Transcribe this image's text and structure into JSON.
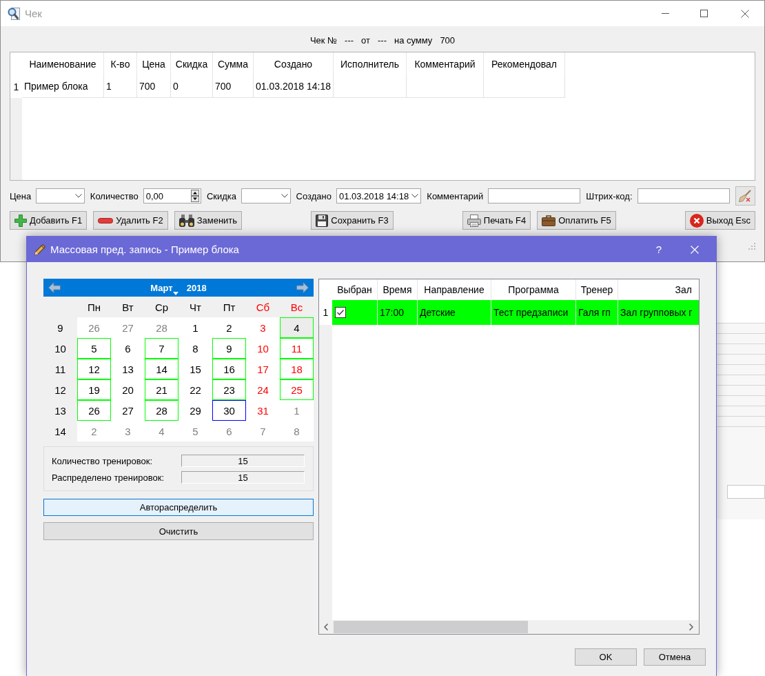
{
  "window": {
    "title": "Чек"
  },
  "receipt_header": [
    "Чек №",
    "---",
    "от",
    "---",
    "на сумму",
    "700"
  ],
  "items_table": {
    "columns": [
      "Наименование",
      "К-во",
      "Цена",
      "Скидка",
      "Сумма",
      "Создано",
      "Исполнитель",
      "Комментарий",
      "Рекомендовал"
    ],
    "rows": [
      {
        "number": "1",
        "cells": [
          "Пример блока",
          "1",
          "700",
          "0",
          "700",
          "01.03.2018 14:18",
          "",
          "",
          ""
        ]
      }
    ]
  },
  "editor_fields": [
    {
      "label": "Цена",
      "kind": "combo"
    },
    {
      "label": "Количество",
      "kind": "spin",
      "value": "0,00"
    },
    {
      "label": "Скидка",
      "kind": "combo"
    },
    {
      "label": "Создано",
      "kind": "combo",
      "value": "01.03.2018 14:18"
    },
    {
      "label": "Комментарий",
      "kind": "text"
    },
    {
      "label": "Штрих-код:",
      "kind": "text"
    }
  ],
  "action_groups": [
    {
      "buttons": [
        {
          "label": "Добавить F1",
          "kind": "add"
        },
        {
          "label": "Удалить F2",
          "kind": "delete"
        },
        {
          "label": "Заменить",
          "kind": "replace"
        }
      ]
    },
    {
      "buttons": [
        {
          "label": "Сохранить F3",
          "kind": "save"
        }
      ]
    },
    {
      "buttons": [
        {
          "label": "Печать F4",
          "kind": "print"
        },
        {
          "label": "Оплатить F5",
          "kind": "pay"
        }
      ]
    },
    {
      "buttons": [
        {
          "label": "Выход Esc",
          "kind": "exit"
        }
      ]
    }
  ],
  "dialog": {
    "title": "Массовая пред. запись - Пример блока",
    "help": "?",
    "calendar": {
      "month": "Март",
      "year": "2018",
      "weekdays": [
        {
          "label": "Пн",
          "weekend": false
        },
        {
          "label": "Вт",
          "weekend": false
        },
        {
          "label": "Ср",
          "weekend": false
        },
        {
          "label": "Чт",
          "weekend": false
        },
        {
          "label": "Пт",
          "weekend": false
        },
        {
          "label": "Сб",
          "weekend": true
        },
        {
          "label": "Вс",
          "weekend": true
        }
      ],
      "weeks": [
        {
          "number": "9",
          "days": [
            {
              "day": "26",
              "muted": true,
              "marked": false,
              "current": false,
              "selected": false
            },
            {
              "day": "27",
              "muted": true,
              "marked": false,
              "current": false,
              "selected": false
            },
            {
              "day": "28",
              "muted": true,
              "marked": false,
              "current": false,
              "selected": false
            },
            {
              "day": "1",
              "muted": false,
              "marked": false,
              "current": false,
              "selected": false
            },
            {
              "day": "2",
              "muted": false,
              "marked": false,
              "current": false,
              "selected": false
            },
            {
              "day": "3",
              "muted": false,
              "marked": false,
              "current": false,
              "selected": false
            },
            {
              "day": "4",
              "muted": false,
              "marked": true,
              "current": false,
              "selected": true
            }
          ]
        },
        {
          "number": "10",
          "days": [
            {
              "day": "5",
              "muted": false,
              "marked": true,
              "current": false,
              "selected": false
            },
            {
              "day": "6",
              "muted": false,
              "marked": false,
              "current": false,
              "selected": false
            },
            {
              "day": "7",
              "muted": false,
              "marked": true,
              "current": false,
              "selected": false
            },
            {
              "day": "8",
              "muted": false,
              "marked": false,
              "current": false,
              "selected": false
            },
            {
              "day": "9",
              "muted": false,
              "marked": true,
              "current": false,
              "selected": false
            },
            {
              "day": "10",
              "muted": false,
              "marked": false,
              "current": false,
              "selected": false
            },
            {
              "day": "11",
              "muted": false,
              "marked": true,
              "current": false,
              "selected": false
            }
          ]
        },
        {
          "number": "11",
          "days": [
            {
              "day": "12",
              "muted": false,
              "marked": true,
              "current": false,
              "selected": false
            },
            {
              "day": "13",
              "muted": false,
              "marked": false,
              "current": false,
              "selected": false
            },
            {
              "day": "14",
              "muted": false,
              "marked": true,
              "current": false,
              "selected": false
            },
            {
              "day": "15",
              "muted": false,
              "marked": false,
              "current": false,
              "selected": false
            },
            {
              "day": "16",
              "muted": false,
              "marked": true,
              "current": false,
              "selected": false
            },
            {
              "day": "17",
              "muted": false,
              "marked": false,
              "current": false,
              "selected": false
            },
            {
              "day": "18",
              "muted": false,
              "marked": true,
              "current": false,
              "selected": false
            }
          ]
        },
        {
          "number": "12",
          "days": [
            {
              "day": "19",
              "muted": false,
              "marked": true,
              "current": false,
              "selected": false
            },
            {
              "day": "20",
              "muted": false,
              "marked": false,
              "current": false,
              "selected": false
            },
            {
              "day": "21",
              "muted": false,
              "marked": true,
              "current": false,
              "selected": false
            },
            {
              "day": "22",
              "muted": false,
              "marked": false,
              "current": false,
              "selected": false
            },
            {
              "day": "23",
              "muted": false,
              "marked": true,
              "current": false,
              "selected": false
            },
            {
              "day": "24",
              "muted": false,
              "marked": false,
              "current": false,
              "selected": false
            },
            {
              "day": "25",
              "muted": false,
              "marked": true,
              "current": false,
              "selected": false
            }
          ]
        },
        {
          "number": "13",
          "days": [
            {
              "day": "26",
              "muted": false,
              "marked": true,
              "current": false,
              "selected": false
            },
            {
              "day": "27",
              "muted": false,
              "marked": false,
              "current": false,
              "selected": false
            },
            {
              "day": "28",
              "muted": false,
              "marked": true,
              "current": false,
              "selected": false
            },
            {
              "day": "29",
              "muted": false,
              "marked": false,
              "current": false,
              "selected": false
            },
            {
              "day": "30",
              "muted": false,
              "marked": false,
              "current": true,
              "selected": false
            },
            {
              "day": "31",
              "muted": false,
              "marked": false,
              "current": false,
              "selected": false
            },
            {
              "day": "1",
              "muted": true,
              "marked": false,
              "current": false,
              "selected": false
            }
          ]
        },
        {
          "number": "14",
          "days": [
            {
              "day": "2",
              "muted": true,
              "marked": false,
              "current": false,
              "selected": false
            },
            {
              "day": "3",
              "muted": true,
              "marked": false,
              "current": false,
              "selected": false
            },
            {
              "day": "4",
              "muted": true,
              "marked": false,
              "current": false,
              "selected": false
            },
            {
              "day": "5",
              "muted": true,
              "marked": false,
              "current": false,
              "selected": false
            },
            {
              "day": "6",
              "muted": true,
              "marked": false,
              "current": false,
              "selected": false
            },
            {
              "day": "7",
              "muted": true,
              "marked": false,
              "current": false,
              "selected": false
            },
            {
              "day": "8",
              "muted": true,
              "marked": false,
              "current": false,
              "selected": false
            }
          ]
        }
      ]
    },
    "stats": [
      {
        "label": "Количество тренировок:",
        "value": "15"
      },
      {
        "label": "Распределено тренировок:",
        "value": "15"
      }
    ],
    "buttons": [
      {
        "label": "Автораспределить",
        "focused": true
      },
      {
        "label": "Очистить",
        "focused": false
      }
    ],
    "schedule_table": {
      "columns": [
        "Выбран",
        "Время",
        "Направление",
        "Программа",
        "Тренер",
        "Зал"
      ],
      "rows": [
        {
          "number": "1",
          "highlighted": true,
          "checked": true,
          "cells": [
            "",
            "17:00",
            "Детские",
            "Тест предзаписи",
            "Галя гп",
            "Зал групповых г"
          ]
        }
      ]
    },
    "footer_buttons": [
      "OK",
      "Отмена"
    ]
  }
}
